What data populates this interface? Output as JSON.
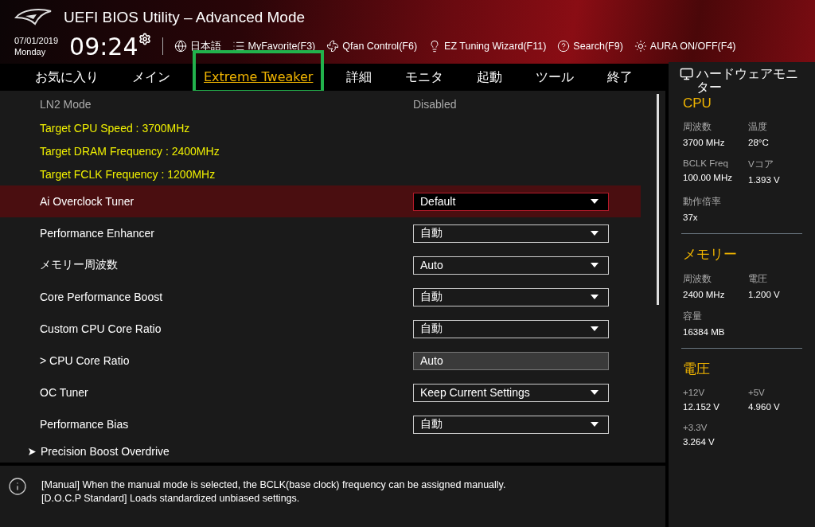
{
  "header": {
    "title": "UEFI BIOS Utility – Advanced Mode",
    "date": "07/01/2019",
    "day": "Monday",
    "time": "09:24",
    "toolbar": [
      {
        "label": "日本語"
      },
      {
        "label": "MyFavorite(F3)"
      },
      {
        "label": "Qfan Control(F6)"
      },
      {
        "label": "EZ Tuning Wizard(F11)"
      },
      {
        "label": "Search(F9)"
      },
      {
        "label": "AURA ON/OFF(F4)"
      }
    ]
  },
  "tabs": [
    {
      "label": "お気に入り",
      "selected": false
    },
    {
      "label": "メイン",
      "selected": false
    },
    {
      "label": "Extreme Tweaker",
      "selected": true
    },
    {
      "label": "詳細",
      "selected": false
    },
    {
      "label": "モニタ",
      "selected": false
    },
    {
      "label": "起動",
      "selected": false
    },
    {
      "label": "ツール",
      "selected": false
    },
    {
      "label": "終了",
      "selected": false
    }
  ],
  "settings": [
    {
      "kind": "info",
      "label": "LN2 Mode",
      "value": "Disabled",
      "selected": false
    },
    {
      "kind": "target",
      "label": "Target CPU Speed : 3700MHz",
      "selected": false
    },
    {
      "kind": "target",
      "label": "Target DRAM Frequency : 2400MHz",
      "selected": false
    },
    {
      "kind": "target",
      "label": "Target FCLK Frequency : 1200MHz",
      "selected": false
    },
    {
      "kind": "select",
      "label": "Ai Overclock Tuner",
      "value": "Default",
      "selected": true
    },
    {
      "kind": "select",
      "label": "Performance Enhancer",
      "value": "自動",
      "selected": false
    },
    {
      "kind": "select",
      "label": "メモリー周波数",
      "value": "Auto",
      "selected": false
    },
    {
      "kind": "select",
      "label": "Core Performance Boost",
      "value": "自動",
      "selected": false
    },
    {
      "kind": "select",
      "label": "Custom CPU Core Ratio",
      "value": "自動",
      "selected": false
    },
    {
      "kind": "readonly",
      "label": "> CPU Core Ratio",
      "value": "Auto",
      "selected": false
    },
    {
      "kind": "select",
      "label": "OC Tuner",
      "value": "Keep Current Settings",
      "selected": false
    },
    {
      "kind": "select",
      "label": "Performance Bias",
      "value": "自動",
      "selected": false
    },
    {
      "kind": "submenu",
      "label": "Precision Boost Overdrive",
      "selected": false
    }
  ],
  "help": [
    "[Manual] When the manual mode is selected, the BCLK(base clock) frequency can be assigned manually.",
    "[D.O.C.P Standard] Loads standardized unbiased settings."
  ],
  "hardware_monitor": {
    "title": "ハードウェアモニター",
    "sections": [
      {
        "title": "CPU",
        "items": [
          {
            "label": "周波数",
            "value": "3700 MHz"
          },
          {
            "label": "温度",
            "value": "28°C"
          },
          {
            "label": "BCLK Freq",
            "value": "100.00 MHz"
          },
          {
            "label": "Vコア",
            "value": "1.393 V"
          },
          {
            "label": "動作倍率",
            "value": "37x"
          }
        ]
      },
      {
        "title": "メモリー",
        "items": [
          {
            "label": "周波数",
            "value": "2400 MHz"
          },
          {
            "label": "電圧",
            "value": "1.200 V"
          },
          {
            "label": "容量",
            "value": "16384 MB"
          }
        ]
      },
      {
        "title": "電圧",
        "items": [
          {
            "label": "+12V",
            "value": "12.152 V"
          },
          {
            "label": "+5V",
            "value": "4.960 V"
          },
          {
            "label": "+3.3V",
            "value": "3.264 V"
          }
        ]
      }
    ]
  }
}
